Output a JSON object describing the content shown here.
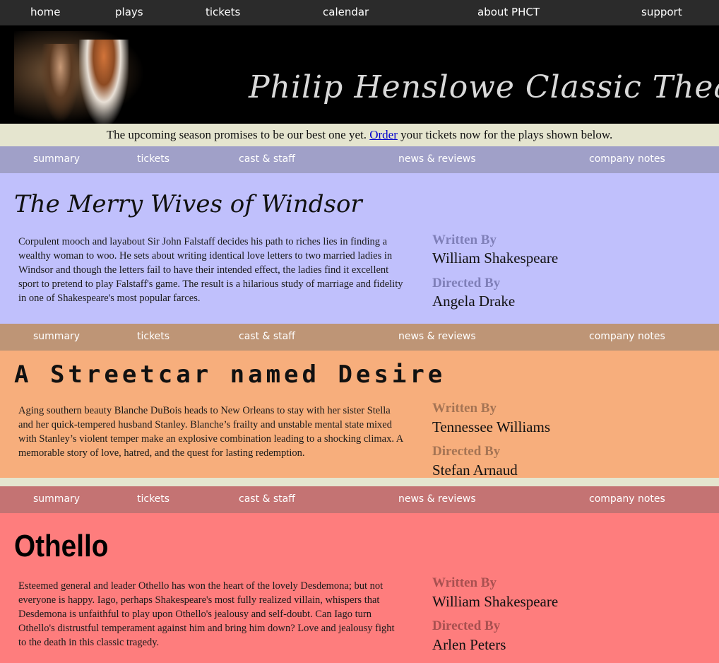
{
  "topnav": [
    "home",
    "plays",
    "tickets",
    "calendar",
    "about PHCT",
    "support"
  ],
  "banner": {
    "title": "Philip Henslowe Classic Theatre"
  },
  "tagline": {
    "before": "The upcoming season promises to be our best one yet. ",
    "link": "Order",
    "after": " your tickets now for the plays shown below."
  },
  "subnav": [
    "summary",
    "tickets",
    "cast & staff",
    "news & reviews",
    "company notes"
  ],
  "labels": {
    "written": "Written By",
    "directed": "Directed By"
  },
  "colors": {
    "nav1": "#a0a0c8",
    "play1": "#c0c0fc",
    "label1": "#7f7fb8",
    "nav2": "#be9576",
    "play2": "#f7ae7c",
    "label2": "#a57454",
    "nav3": "#c47373",
    "play3": "#fe7d7d",
    "label3": "#a85050"
  },
  "plays": [
    {
      "title": "The Merry Wives of Windsor",
      "description": "Corpulent mooch and layabout Sir John Falstaff decides his path to riches lies in finding a wealthy woman to woo. He sets about writing identical love letters to two married ladies in Windsor and though the letters fail to have their intended effect, the ladies find it excellent sport to pretend to play Falstaff's game. The result is a hilarious study of marriage and fidelity in one of Shakespeare's most popular farces.",
      "writer": "William Shakespeare",
      "director": "Angela Drake"
    },
    {
      "title": "A Streetcar named Desire",
      "description": "Aging southern beauty Blanche DuBois heads to New Orleans to stay with her sister Stella and her quick-tempered husband Stanley. Blanche’s frailty and unstable mental state mixed with Stanley’s violent temper make an explosive combination leading to a shocking climax. A memorable story of love, hatred, and the quest for lasting redemption.",
      "writer": "Tennessee Williams",
      "director": "Stefan Arnaud"
    },
    {
      "title": "Othello",
      "description": "Esteemed general and leader Othello has won the heart of the lovely Desdemona; but not everyone is happy. Iago, perhaps Shakespeare's most fully realized villain, whispers that Desdemona is unfaithful to play upon Othello's jealousy and self-doubt. Can Iago turn Othello's distrustful temperament against him and bring him down? Love and jealousy fight to the death in this classic tragedy.",
      "writer": "William Shakespeare",
      "director": "Arlen Peters"
    }
  ]
}
